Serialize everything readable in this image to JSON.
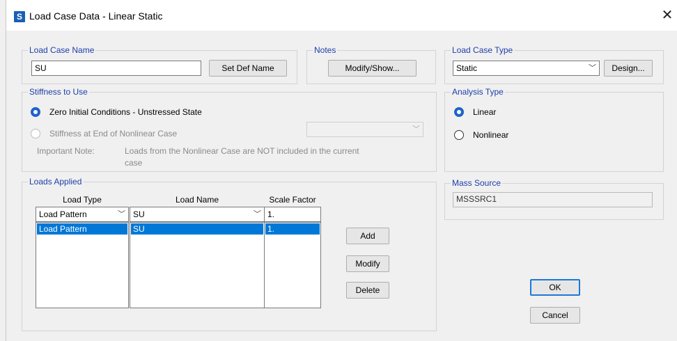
{
  "window": {
    "app_icon": "S",
    "title": "Load Case Data - Linear Static",
    "close_glyph": "✕"
  },
  "load_case_name": {
    "legend": "Load Case Name",
    "value": "SU",
    "set_def_name_button": "Set Def Name"
  },
  "notes": {
    "legend": "Notes",
    "modify_show_button": "Modify/Show..."
  },
  "load_case_type": {
    "legend": "Load Case Type",
    "selected": "Static",
    "design_button": "Design..."
  },
  "stiffness": {
    "legend": "Stiffness to Use",
    "option_zero": "Zero Initial Conditions - Unstressed State",
    "option_end_nonlinear": "Stiffness at End of Nonlinear Case",
    "note_label": "Important Note:",
    "note_text_line1": "Loads from the Nonlinear Case are NOT included in the current",
    "note_text_line2": "case"
  },
  "analysis_type": {
    "legend": "Analysis Type",
    "linear": "Linear",
    "nonlinear": "Nonlinear"
  },
  "mass_source": {
    "legend": "Mass Source",
    "value": "MSSSRC1"
  },
  "loads_applied": {
    "legend": "Loads Applied",
    "headers": {
      "load_type": "Load Type",
      "load_name": "Load Name",
      "scale_factor": "Scale Factor"
    },
    "input_row": {
      "load_type": "Load Pattern",
      "load_name": "SU",
      "scale_factor": "1."
    },
    "rows": [
      {
        "load_type": "Load Pattern",
        "load_name": "SU",
        "scale_factor": "1."
      }
    ],
    "add_button": "Add",
    "modify_button": "Modify",
    "delete_button": "Delete"
  },
  "dialog_buttons": {
    "ok": "OK",
    "cancel": "Cancel"
  },
  "icons": {
    "chevron": "﹀",
    "radio_selected": "radio-selected-icon",
    "radio_unselected": "radio-unselected-icon"
  },
  "colors": {
    "accent": "#0078d7",
    "legend_text": "#1e3ea8",
    "radio_on": "#1e63c9"
  }
}
